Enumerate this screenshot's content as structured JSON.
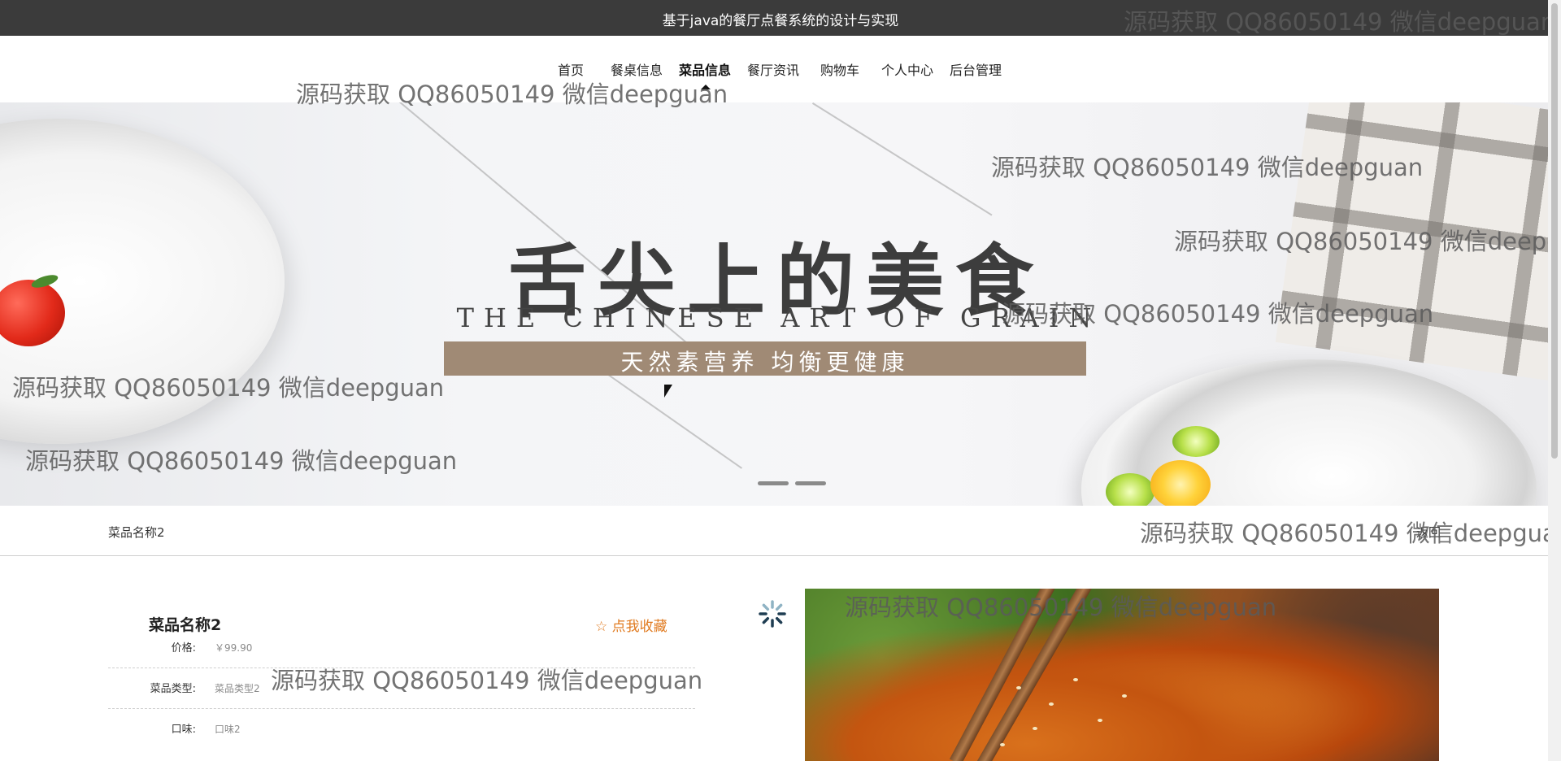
{
  "header": {
    "site_title": "基于java的餐厅点餐系统的设计与实现"
  },
  "nav": {
    "items": [
      {
        "label": "首页",
        "active": false
      },
      {
        "label": "餐桌信息",
        "active": false
      },
      {
        "label": "菜品信息",
        "active": true
      },
      {
        "label": "餐厅资讯",
        "active": false
      },
      {
        "label": "购物车",
        "active": false
      },
      {
        "label": "个人中心",
        "active": false
      },
      {
        "label": "后台管理",
        "active": false
      }
    ]
  },
  "banner": {
    "headline": "舌尖上的美食",
    "subline_en": "THE CHINESE ART OF GRAIN",
    "slogan": "天然素营养 均衡更健康",
    "slide_count": 2
  },
  "breadcrumb": {
    "current": "菜品名称2",
    "back_label": "返回"
  },
  "detail": {
    "dish_name": "菜品名称2",
    "favorite_label": "☆ 点我收藏",
    "fields": [
      {
        "label": "价格:",
        "value": "￥99.90"
      },
      {
        "label": "菜品类型:",
        "value": "菜品类型2"
      },
      {
        "label": "口味:",
        "value": "口味2"
      }
    ]
  },
  "watermark": {
    "text": "源码获取 QQ86050149 微信deepguan"
  },
  "colors": {
    "topbar_bg": "#3b3b3b",
    "favorite": "#e07a1f",
    "slogan_bg": "#a08a75"
  }
}
